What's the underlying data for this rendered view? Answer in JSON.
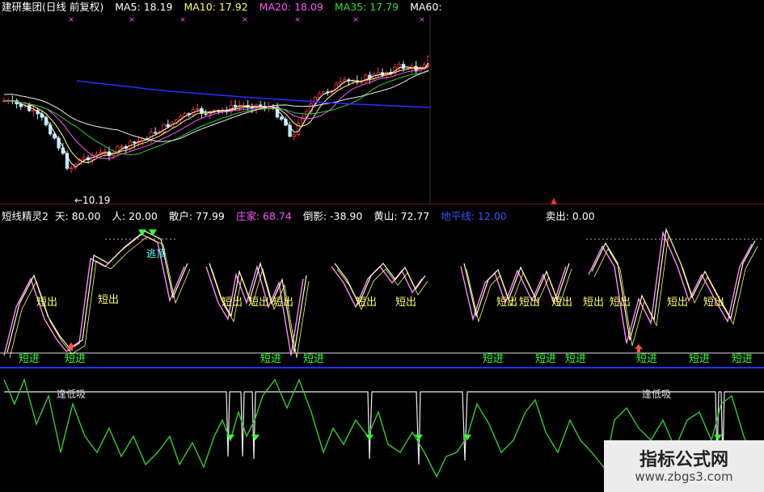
{
  "main": {
    "title": "建研集团(日线 前复权)",
    "ma": [
      {
        "label": "MA5: 18.19",
        "color": "#ffffff"
      },
      {
        "label": "MA10: 17.92",
        "color": "#ffff66"
      },
      {
        "label": "MA20: 18.09",
        "color": "#ff55ff"
      },
      {
        "label": "MA35: 17.79",
        "color": "#33dd33"
      },
      {
        "label": "MA60:",
        "color": "#ffffff"
      }
    ],
    "low_label": "←10.19"
  },
  "indicator": {
    "name": "短线精灵2",
    "values": [
      {
        "label": "天: 80.00",
        "color": "#ffffff"
      },
      {
        "label": "人: 20.00",
        "color": "#ffffff"
      },
      {
        "label": "散户: 77.99",
        "color": "#ffffff"
      },
      {
        "label": "庄家: 68.74",
        "color": "#ff55ff"
      },
      {
        "label": "倒影: -38.90",
        "color": "#ffffff"
      },
      {
        "label": "黄山: 72.77",
        "color": "#ffffff"
      },
      {
        "label": "地平线: 12.00",
        "color": "#3355ff"
      },
      {
        "label": "卖出: 0.00",
        "color": "#ffffff"
      }
    ],
    "signals": {
      "short_out": "短出",
      "short_in": "短进",
      "escape_top": "逃顶",
      "low_buy": "逢低吸"
    }
  },
  "watermark": {
    "title": "指标公式网",
    "url": "www.zbgs3.com"
  },
  "colors": {
    "up": "#ff3030",
    "down": "#bfe8ff",
    "ma_blue": "#2a2aff",
    "green_line": "#33cc33",
    "signal_text": "#ffff66",
    "signal_green": "#33ff33"
  }
}
